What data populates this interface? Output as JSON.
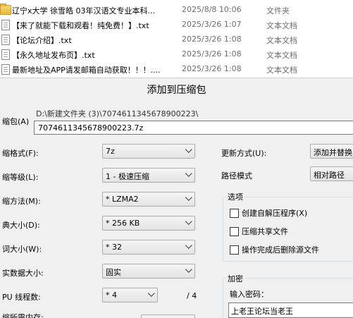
{
  "files": [
    {
      "name": "辽宁x大学 徐雪皓 03年汉语文专业本科...",
      "date": "2025/8/8 10:06",
      "type": "文件夹",
      "icon": "folder-icon"
    },
    {
      "name": "【来了就能下载和观看！纯免费！】.txt",
      "date": "2025/3/26 1:07",
      "type": "文本文档",
      "icon": "text-file-icon"
    },
    {
      "name": "【论坛介绍】.txt",
      "date": "2025/3/26 1:08",
      "type": "文本文档",
      "icon": "text-file-icon"
    },
    {
      "name": "【永久地址发布页】.txt",
      "date": "2025/3/26 1:08",
      "type": "文本文档",
      "icon": "text-file-icon"
    },
    {
      "name": "最新地址及APP请发邮箱自动获取！！！....",
      "date": "2025/3/26 1:08",
      "type": "文本文档",
      "icon": "text-file-icon"
    }
  ],
  "dialog": {
    "title": "添加到压缩包",
    "archive_label": "缩包(A)",
    "archive_dir": "D:\\新建文件夹 (3)\\7074611345678900223\\",
    "archive_name": "7074611345678900223.7z",
    "left": {
      "format_label": "缩格式(F):",
      "format_value": "7z",
      "level_label": "缩等级(L):",
      "level_value": "1 - 极速压缩",
      "method_label": "缩方法(M):",
      "method_value": "* LZMA2",
      "dict_label": "典大小(D):",
      "dict_value": "* 256 KB",
      "word_label": "词大小(W):",
      "word_value": "* 32",
      "solid_label": "实数据大小:",
      "solid_value": "固实",
      "cpu_label": "PU 线程数:",
      "cpu_value": "* 4",
      "cpu_total": "/ 4",
      "mem_label": "缩所需内存:"
    },
    "right": {
      "update_label": "更新方式(U):",
      "update_value": "添加并替换",
      "path_label": "路径模式",
      "path_value": "相对路径",
      "options_title": "选项",
      "options": [
        "创建自解压程序(X)",
        "压缩共享文件",
        "操作完成后删除源文件"
      ],
      "encrypt_title": "加密",
      "password_label": "输入密码：",
      "password_value": "上老王论坛当老王"
    }
  }
}
